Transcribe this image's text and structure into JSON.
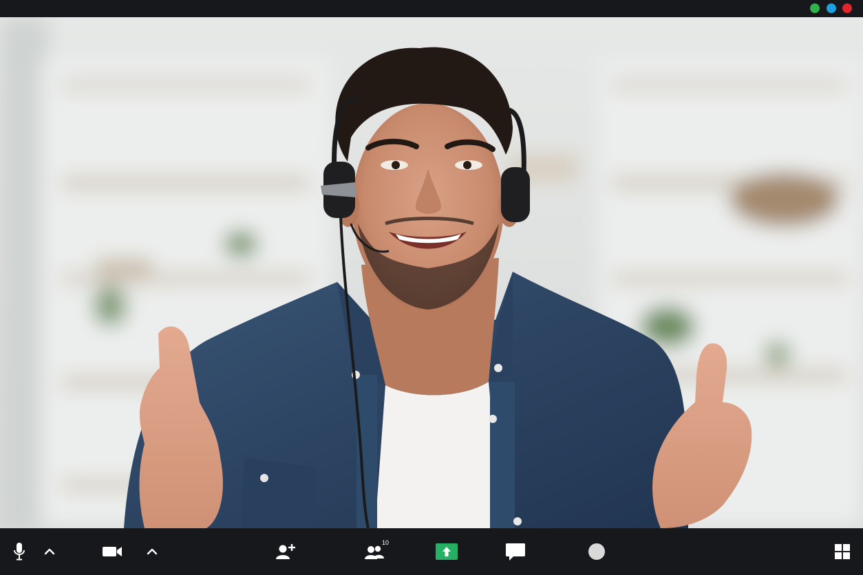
{
  "window": {
    "controls": [
      {
        "name": "green-window-button",
        "color": "#2fb34a"
      },
      {
        "name": "blue-window-button",
        "color": "#1ba1e2"
      },
      {
        "name": "red-window-button",
        "color": "#e0262c"
      }
    ]
  },
  "video": {
    "participant_view": "speaker-video-feed"
  },
  "toolbar": {
    "icon_color": "#ffffff",
    "share_color": "#25b064",
    "participants_count": "10",
    "icons": [
      "microphone-icon",
      "mic-options-chevron-icon",
      "video-camera-icon",
      "video-options-chevron-icon",
      "invite-participant-icon",
      "participants-icon",
      "share-screen-icon",
      "chat-icon",
      "record-icon",
      "gallery-view-icon"
    ]
  }
}
